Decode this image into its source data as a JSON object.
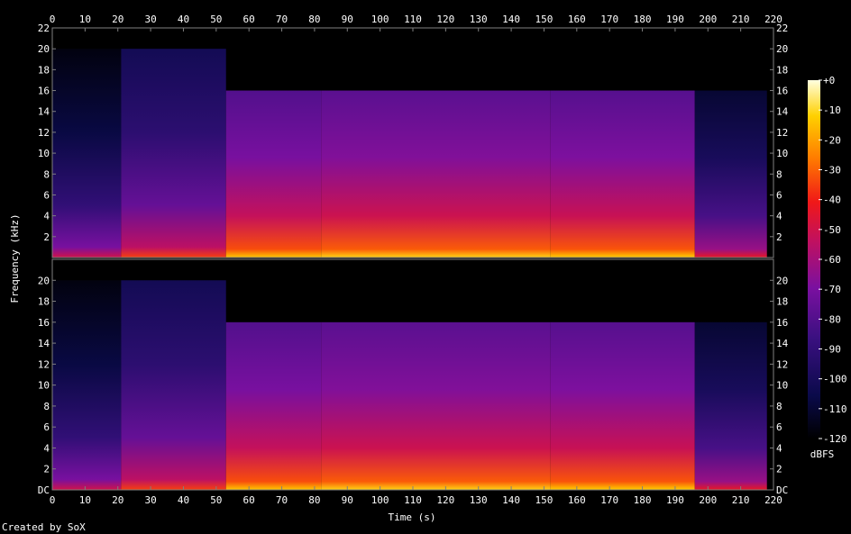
{
  "chart_data": {
    "type": "heatmap",
    "title": "",
    "xlabel": "Time (s)",
    "ylabel": "Frequency (kHz)",
    "colorbar_label": "dBFS",
    "footer": "Created by SoX",
    "xlim": [
      0,
      220
    ],
    "ylim_khz": [
      0,
      22
    ],
    "x_ticks": [
      "0",
      "10",
      "20",
      "30",
      "40",
      "50",
      "60",
      "70",
      "80",
      "90",
      "100",
      "110",
      "120",
      "130",
      "140",
      "150",
      "160",
      "170",
      "180",
      "190",
      "200",
      "210",
      "220"
    ],
    "y_ticks_top_channel": [
      "2",
      "4",
      "6",
      "8",
      "10",
      "12",
      "14",
      "16",
      "18",
      "20",
      "22"
    ],
    "y_ticks_bottom_channel": [
      "DC",
      "2",
      "4",
      "6",
      "8",
      "10",
      "12",
      "14",
      "16",
      "18",
      "20"
    ],
    "colorbar_ticks": [
      "+0",
      "-10",
      "-20",
      "-30",
      "-40",
      "-50",
      "-60",
      "-70",
      "-80",
      "-90",
      "-100",
      "-110",
      "-120"
    ],
    "colorbar_range_dbfs": [
      -120,
      0
    ],
    "channels": 2,
    "segments": [
      {
        "start": 0,
        "end": 21,
        "cutoff_khz": 20,
        "level_dbfs": -95
      },
      {
        "start": 21,
        "end": 53,
        "cutoff_khz": 20,
        "level_dbfs": -80
      },
      {
        "start": 53,
        "end": 82,
        "cutoff_khz": 16,
        "level_dbfs": -58
      },
      {
        "start": 82,
        "end": 152,
        "cutoff_khz": 16,
        "level_dbfs": -56
      },
      {
        "start": 152,
        "end": 196,
        "cutoff_khz": 16,
        "level_dbfs": -57
      },
      {
        "start": 196,
        "end": 218,
        "cutoff_khz": 16,
        "level_dbfs": -88
      }
    ],
    "colors": {
      "background": "#000000",
      "axis": "#7f7f7f",
      "text": "#ffffff"
    }
  }
}
